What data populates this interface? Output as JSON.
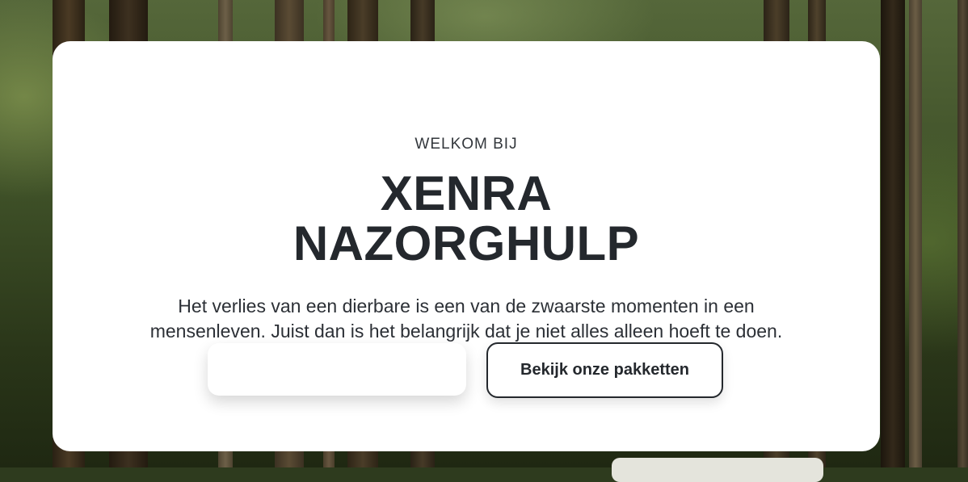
{
  "hero": {
    "eyebrow": "WELKOM BIJ",
    "title_line1": "XENRA",
    "title_line2": "NAZORGHULP",
    "intro_line1": "Het verlies van een dierbare is een van de zwaarste momenten in een",
    "intro_line2": "mensenleven. Juist dan is het belangrijk dat je niet alles alleen hoeft te doen.",
    "primary_button_label": "",
    "secondary_button_label": "Bekijk onze pakketten"
  },
  "colors": {
    "text": "#24282d",
    "card": "#ffffff",
    "background": "#3f5128"
  }
}
